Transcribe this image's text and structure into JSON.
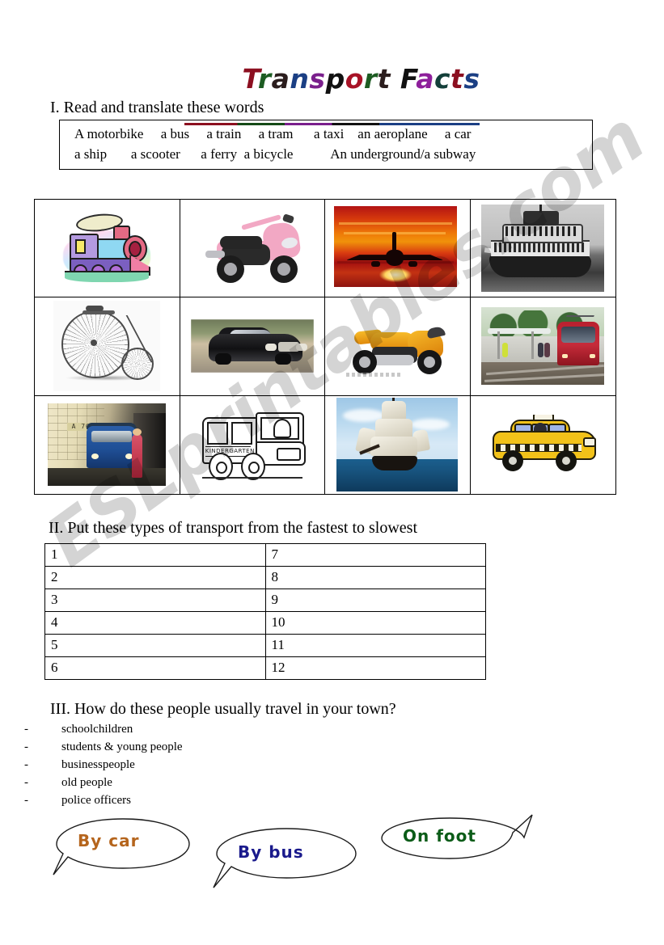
{
  "document": {
    "title": "Transport Facts",
    "title_letters": [
      {
        "ch": "T",
        "color": "#8c0f20"
      },
      {
        "ch": "r",
        "color": "#1d5c22"
      },
      {
        "ch": "a",
        "color": "#2b1d1d"
      },
      {
        "ch": "n",
        "color": "#1b3f84"
      },
      {
        "ch": "s",
        "color": "#7a1f8c"
      },
      {
        "ch": "p",
        "color": "#111111"
      },
      {
        "ch": "o",
        "color": "#a81327"
      },
      {
        "ch": "r",
        "color": "#1d5c22"
      },
      {
        "ch": "t",
        "color": "#2b1d1d"
      },
      {
        "ch": " ",
        "color": "#000000"
      },
      {
        "ch": "F",
        "color": "#111111"
      },
      {
        "ch": "a",
        "color": "#8e1f9b"
      },
      {
        "ch": "c",
        "color": "#14403a"
      },
      {
        "ch": "t",
        "color": "#8c0f20"
      },
      {
        "ch": "s",
        "color": "#1b3f84"
      }
    ]
  },
  "watermark": {
    "text": "ESLprintables.com"
  },
  "section1": {
    "heading": "I. Read and translate these words",
    "wordbank_line1": "A motorbike     a bus     a train     a tram      a taxi    an aeroplane     a car",
    "wordbank_line2": "a ship       a scooter      a ferry  a bicycle           An underground/a subway",
    "words": [
      "A motorbike",
      "a bus",
      "a train",
      "a tram",
      "a taxi",
      "an aeroplane",
      "a car",
      "a ship",
      "a scooter",
      "a ferry",
      "a bicycle",
      "An underground/a subway"
    ]
  },
  "picture_grid": {
    "cells": [
      {
        "name": "train-image",
        "caption": "cartoon steam train"
      },
      {
        "name": "scooter-image",
        "caption": "pink scooter"
      },
      {
        "name": "aeroplane-image",
        "caption": "aeroplane at sunset"
      },
      {
        "name": "ferry-image",
        "caption": "black and white ferry"
      },
      {
        "name": "bicycle-image",
        "caption": "penny farthing bicycle"
      },
      {
        "name": "car-image",
        "caption": "black car"
      },
      {
        "name": "motorbike-image",
        "caption": "orange sport motorbike"
      },
      {
        "name": "tram-image",
        "caption": "red tram at station"
      },
      {
        "name": "underground-image",
        "caption": "underground train in station"
      },
      {
        "name": "bus-image",
        "caption": "cartoon kindergarten bus"
      },
      {
        "name": "ship-image",
        "caption": "tall sailing ship at sea"
      },
      {
        "name": "taxi-image",
        "caption": "yellow cartoon taxi"
      }
    ],
    "bus_sign_text": "KINDERGARTEN",
    "metro_sign_text": "A 70"
  },
  "section2": {
    "heading": "II. Put these types of transport from the fastest to slowest",
    "rows": [
      {
        "left": "1",
        "right": "7"
      },
      {
        "left": "2",
        "right": "8"
      },
      {
        "left": "3",
        "right": "9"
      },
      {
        "left": "4",
        "right": "10"
      },
      {
        "left": "5",
        "right": "11"
      },
      {
        "left": "6",
        "right": "12"
      }
    ]
  },
  "section3": {
    "heading": "III. How do these people usually travel in your town?",
    "bullet": "-",
    "items": [
      "schoolchildren",
      "students & young people",
      "businesspeople",
      "old people",
      "police officers"
    ]
  },
  "bubbles": [
    {
      "name": "bubble-by-car",
      "text": "By car",
      "color": "#b5651d"
    },
    {
      "name": "bubble-by-bus",
      "text": "By bus",
      "color": "#1a1a8c"
    },
    {
      "name": "bubble-on-foot",
      "text": "On foot",
      "color": "#0b5c18"
    }
  ]
}
